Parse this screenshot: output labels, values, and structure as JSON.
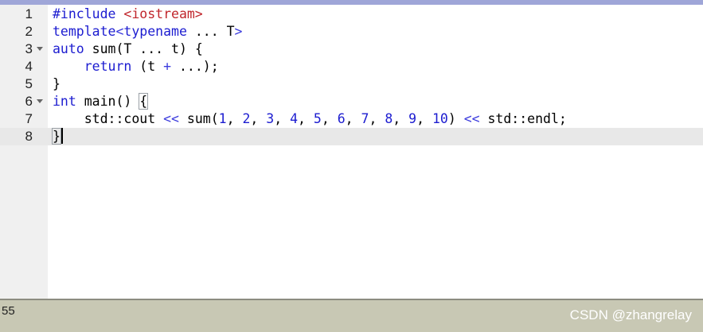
{
  "colors": {
    "keyword": "#1c1cd0",
    "preprocessor": "#1c1cd0",
    "string": "#c0262c",
    "number": "#1c1cd0",
    "operator": "#3b3bdd",
    "text": "#000000",
    "gutter": "#f0f0f0",
    "current_line": "#e8e8e8",
    "status_bar": "#c8c8b4"
  },
  "editor": {
    "line_numbers": [
      "1",
      "2",
      "3",
      "4",
      "5",
      "6",
      "7",
      "8"
    ],
    "current_line": 8,
    "fold_markers": [
      3,
      6
    ],
    "lines": [
      [
        {
          "t": "#include ",
          "c": "preprocessor"
        },
        {
          "t": "<iostream>",
          "c": "string"
        }
      ],
      [
        {
          "t": "template",
          "c": "keyword"
        },
        {
          "t": "<",
          "c": "operator"
        },
        {
          "t": "typename",
          "c": "keyword"
        },
        {
          "t": " ... T",
          "c": "text"
        },
        {
          "t": ">",
          "c": "operator"
        }
      ],
      [
        {
          "t": "auto",
          "c": "keyword"
        },
        {
          "t": " sum(T ... t) {",
          "c": "text"
        }
      ],
      [
        {
          "t": "    ",
          "c": "text"
        },
        {
          "t": "return",
          "c": "keyword"
        },
        {
          "t": " (t ",
          "c": "text"
        },
        {
          "t": "+",
          "c": "operator"
        },
        {
          "t": " ...);",
          "c": "text"
        }
      ],
      [
        {
          "t": "}",
          "c": "text"
        }
      ],
      [
        {
          "t": "int",
          "c": "keyword"
        },
        {
          "t": " main() ",
          "c": "text"
        },
        {
          "t": "{",
          "c": "text",
          "bm": true
        }
      ],
      [
        {
          "t": "    std::cout ",
          "c": "text"
        },
        {
          "t": "<<",
          "c": "operator"
        },
        {
          "t": " sum(",
          "c": "text"
        },
        {
          "t": "1",
          "c": "number"
        },
        {
          "t": ", ",
          "c": "text"
        },
        {
          "t": "2",
          "c": "number"
        },
        {
          "t": ", ",
          "c": "text"
        },
        {
          "t": "3",
          "c": "number"
        },
        {
          "t": ", ",
          "c": "text"
        },
        {
          "t": "4",
          "c": "number"
        },
        {
          "t": ", ",
          "c": "text"
        },
        {
          "t": "5",
          "c": "number"
        },
        {
          "t": ", ",
          "c": "text"
        },
        {
          "t": "6",
          "c": "number"
        },
        {
          "t": ", ",
          "c": "text"
        },
        {
          "t": "7",
          "c": "number"
        },
        {
          "t": ", ",
          "c": "text"
        },
        {
          "t": "8",
          "c": "number"
        },
        {
          "t": ", ",
          "c": "text"
        },
        {
          "t": "9",
          "c": "number"
        },
        {
          "t": ", ",
          "c": "text"
        },
        {
          "t": "10",
          "c": "number"
        },
        {
          "t": ") ",
          "c": "text"
        },
        {
          "t": "<<",
          "c": "operator"
        },
        {
          "t": " std::endl;",
          "c": "text"
        }
      ],
      [
        {
          "t": "}",
          "c": "text",
          "bm": true
        }
      ]
    ]
  },
  "status_bar": {
    "left_text": "55"
  },
  "watermark": "CSDN @zhangrelay"
}
